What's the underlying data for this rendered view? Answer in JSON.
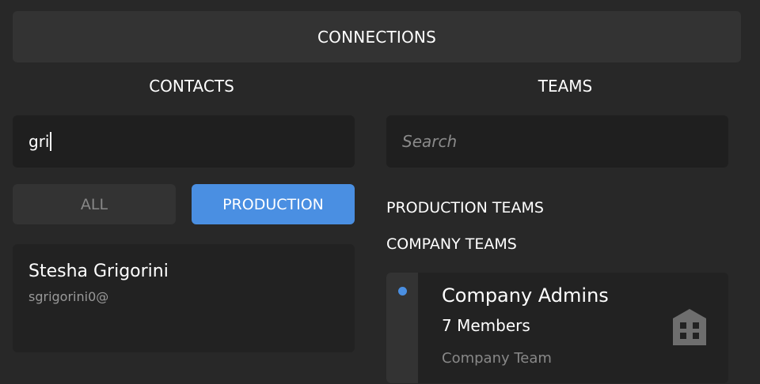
{
  "header": {
    "title": "CONNECTIONS"
  },
  "contacts": {
    "title": "CONTACTS",
    "search_value": "gri",
    "filters": {
      "all": "ALL",
      "production": "PRODUCTION"
    },
    "active_filter": "PRODUCTION",
    "results": [
      {
        "name": "Stesha Grigorini",
        "email": "sgrigorini0@"
      }
    ]
  },
  "teams": {
    "title": "TEAMS",
    "search_placeholder": "Search",
    "sections": {
      "production": "PRODUCTION TEAMS",
      "company": "COMPANY TEAMS"
    },
    "items": [
      {
        "name": "Company Admins",
        "members": "7 Members",
        "type": "Company Team",
        "icon": "building-icon"
      }
    ]
  },
  "colors": {
    "accent": "#4a8fe2",
    "background": "#282828"
  }
}
